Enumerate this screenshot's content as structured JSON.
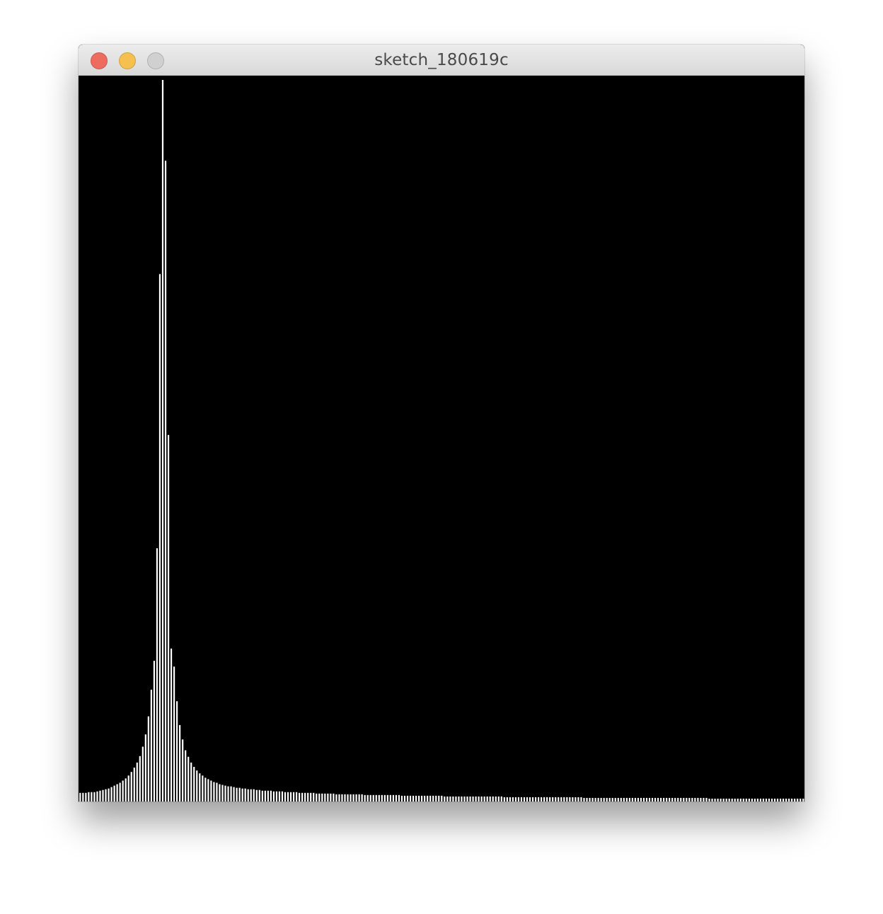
{
  "window": {
    "title": "sketch_180619c",
    "controls": {
      "close_color": "#ee6b5f",
      "minimize_color": "#f5c04f",
      "zoom_color": "#d0d0d0"
    }
  },
  "canvas": {
    "background": "#000000",
    "bar_color": "#ffffff"
  },
  "chart_data": {
    "type": "bar",
    "bar_count": 256,
    "ylim": [
      0,
      1
    ],
    "values": [
      0.012,
      0.012,
      0.012,
      0.013,
      0.013,
      0.013,
      0.014,
      0.015,
      0.016,
      0.017,
      0.018,
      0.02,
      0.022,
      0.024,
      0.026,
      0.029,
      0.032,
      0.036,
      0.041,
      0.047,
      0.054,
      0.063,
      0.076,
      0.093,
      0.118,
      0.155,
      0.195,
      0.351,
      0.731,
      1.0,
      0.888,
      0.508,
      0.212,
      0.187,
      0.139,
      0.106,
      0.086,
      0.071,
      0.062,
      0.054,
      0.048,
      0.043,
      0.039,
      0.036,
      0.033,
      0.031,
      0.029,
      0.027,
      0.026,
      0.024,
      0.023,
      0.022,
      0.021,
      0.021,
      0.02,
      0.019,
      0.019,
      0.018,
      0.018,
      0.017,
      0.017,
      0.017,
      0.016,
      0.016,
      0.015,
      0.015,
      0.015,
      0.015,
      0.014,
      0.014,
      0.014,
      0.014,
      0.013,
      0.013,
      0.013,
      0.013,
      0.013,
      0.012,
      0.012,
      0.012,
      0.012,
      0.012,
      0.012,
      0.011,
      0.011,
      0.011,
      0.011,
      0.011,
      0.011,
      0.011,
      0.01,
      0.01,
      0.01,
      0.01,
      0.01,
      0.01,
      0.01,
      0.01,
      0.01,
      0.01,
      0.009,
      0.009,
      0.009,
      0.009,
      0.009,
      0.009,
      0.009,
      0.009,
      0.009,
      0.009,
      0.009,
      0.009,
      0.009,
      0.008,
      0.008,
      0.008,
      0.008,
      0.008,
      0.008,
      0.008,
      0.008,
      0.008,
      0.008,
      0.008,
      0.008,
      0.008,
      0.008,
      0.008,
      0.007,
      0.007,
      0.007,
      0.007,
      0.007,
      0.007,
      0.007,
      0.007,
      0.007,
      0.007,
      0.007,
      0.007,
      0.007,
      0.007,
      0.007,
      0.007,
      0.007,
      0.007,
      0.007,
      0.007,
      0.007,
      0.006,
      0.006,
      0.006,
      0.006,
      0.006,
      0.006,
      0.006,
      0.006,
      0.006,
      0.006,
      0.006,
      0.006,
      0.006,
      0.006,
      0.006,
      0.006,
      0.006,
      0.006,
      0.006,
      0.006,
      0.006,
      0.006,
      0.006,
      0.006,
      0.006,
      0.006,
      0.006,
      0.006,
      0.005,
      0.005,
      0.005,
      0.005,
      0.005,
      0.005,
      0.005,
      0.005,
      0.005,
      0.005,
      0.005,
      0.005,
      0.005,
      0.005,
      0.005,
      0.005,
      0.005,
      0.005,
      0.005,
      0.005,
      0.005,
      0.005,
      0.005,
      0.005,
      0.005,
      0.005,
      0.005,
      0.005,
      0.005,
      0.005,
      0.005,
      0.005,
      0.005,
      0.005,
      0.005,
      0.005,
      0.005,
      0.005,
      0.005,
      0.005,
      0.005,
      0.005,
      0.005,
      0.005,
      0.004,
      0.004,
      0.004,
      0.004,
      0.004,
      0.004,
      0.004,
      0.004,
      0.004,
      0.004,
      0.004,
      0.004,
      0.004,
      0.004,
      0.004,
      0.004,
      0.004,
      0.004,
      0.004,
      0.004,
      0.004,
      0.004,
      0.004,
      0.004,
      0.004,
      0.004,
      0.004,
      0.004,
      0.004,
      0.004,
      0.004,
      0.004,
      0.004,
      0.004
    ]
  }
}
